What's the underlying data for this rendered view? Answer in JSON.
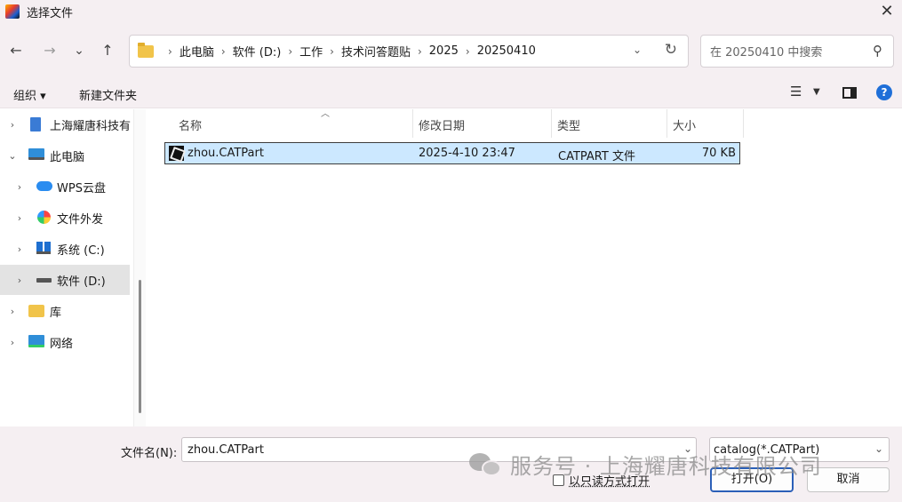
{
  "window": {
    "title": "选择文件",
    "close_glyph": "✕"
  },
  "nav": {
    "back_glyph": "←",
    "forward_glyph": "→",
    "recent_glyph": "⌄",
    "up_glyph": "↑",
    "breadcrumbs": [
      "此电脑",
      "软件 (D:)",
      "工作",
      "技术问答题贴",
      "2025",
      "20250410"
    ],
    "refresh_glyph": "↻",
    "search_placeholder": "在 20250410 中搜索"
  },
  "commands": {
    "organize": "组织 ▾",
    "new_folder": "新建文件夹",
    "help": "?"
  },
  "sidebar": {
    "items": [
      {
        "label": "上海耀唐科技有",
        "icon": "building-icon",
        "indent": 1
      },
      {
        "label": "此电脑",
        "icon": "computer-icon",
        "indent": 0,
        "expanded": true
      },
      {
        "label": "WPS云盘",
        "icon": "cloud-icon",
        "indent": 1
      },
      {
        "label": "文件外发",
        "icon": "share-icon",
        "indent": 1
      },
      {
        "label": "系统 (C:)",
        "icon": "windows-drive-icon",
        "indent": 1
      },
      {
        "label": "软件 (D:)",
        "icon": "drive-icon",
        "indent": 1,
        "selected": true
      },
      {
        "label": "库",
        "icon": "library-icon",
        "indent": 0
      },
      {
        "label": "网络",
        "icon": "network-icon",
        "indent": 0
      }
    ]
  },
  "columns": {
    "name": "名称",
    "date": "修改日期",
    "type": "类型",
    "size": "大小"
  },
  "files": [
    {
      "name": "zhou.CATPart",
      "date": "2025-4-10 23:47",
      "type": "CATPART 文件",
      "size": "70 KB"
    }
  ],
  "bottom": {
    "filename_label": "文件名(N):",
    "filename_value": "zhou.CATPart",
    "filetype_value": "catalog(*.CATPart)",
    "readonly_label": "以只读方式打开",
    "open_label": "打开(O)",
    "cancel_label": "取消"
  },
  "watermark": {
    "text": "服务号 · 上海耀唐科技有限公司"
  },
  "colors": {
    "selection": "#cce8ff",
    "chrome": "#f5eff2",
    "accent": "#1f6fd8"
  }
}
